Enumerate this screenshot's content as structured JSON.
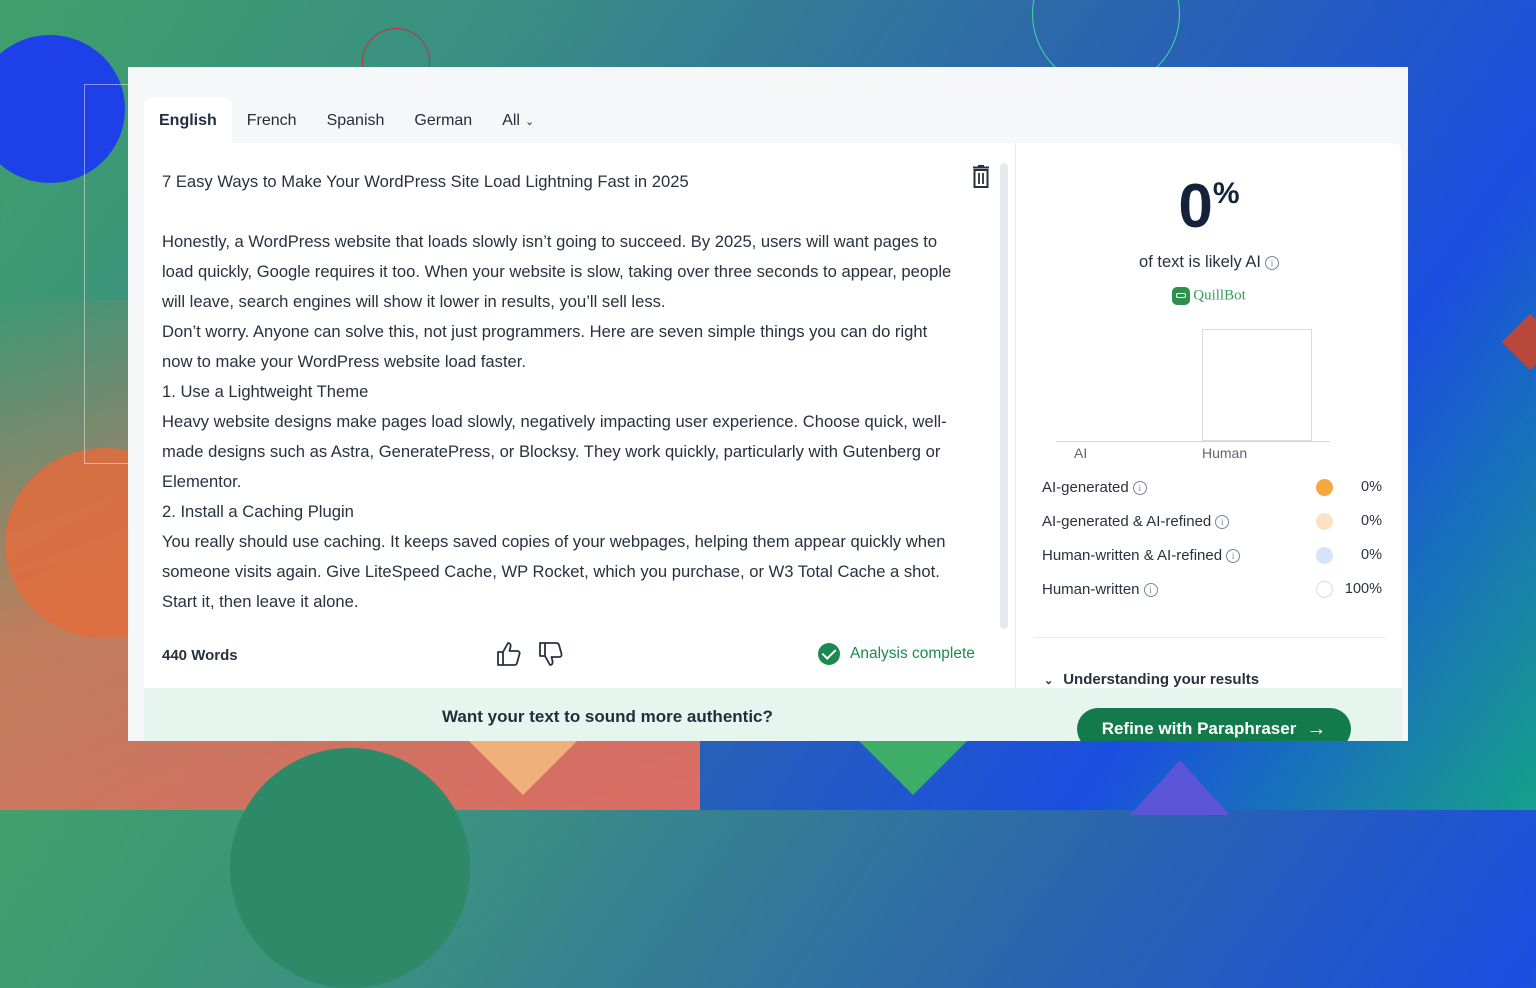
{
  "tabs": [
    {
      "label": "English",
      "active": true
    },
    {
      "label": "French"
    },
    {
      "label": "Spanish"
    },
    {
      "label": "German"
    },
    {
      "label": "All",
      "icon": "chevron-down-icon"
    }
  ],
  "editor": {
    "title": "7 Easy Ways to Make Your WordPress Site Load Lightning Fast in 2025",
    "paragraphs": [
      "Honestly, a WordPress website that loads slowly isn’t going to succeed. By 2025, users will want pages to load quickly, Google requires it too. When your website is slow, taking over three seconds to appear, people will leave, search engines will show it lower in results, you’ll sell less.",
      "Don’t worry. Anyone can solve this, not just programmers. Here are seven simple things you can do right now to make your WordPress website load faster.",
      "1. Use a Lightweight Theme",
      "Heavy website designs make pages load slowly, negatively impacting user experience. Choose quick, well-made designs such as Astra, GeneratePress, or Blocksy. They work quickly, particularly with Gutenberg or Elementor.",
      "2. Install a Caching Plugin",
      "You really should use caching. It keeps saved copies of your webpages, helping them appear quickly when someone visits again. Give LiteSpeed Cache, WP Rocket, which you purchase, or W3 Total Cache a shot. Start it, then leave it alone."
    ],
    "word_count": "440 Words",
    "status": "Analysis complete",
    "icons": {
      "delete": "trash-icon",
      "like": "thumbs-up-icon",
      "dislike": "thumbs-down-icon",
      "status": "check-circle-icon"
    }
  },
  "results": {
    "percent": "0",
    "percent_symbol": "%",
    "caption": "of text is likely AI",
    "brand": "QuillBot",
    "legend": [
      {
        "label": "AI-generated",
        "value": "0%",
        "color": "#f5a742"
      },
      {
        "label": "AI-generated & AI-refined",
        "value": "0%",
        "color": "#fbe2c4"
      },
      {
        "label": "Human-written & AI-refined",
        "value": "0%",
        "color": "#d6e4fb"
      },
      {
        "label": "Human-written",
        "value": "100%",
        "color": "#ffffff"
      }
    ],
    "understanding": "Understanding your results"
  },
  "chart_data": {
    "type": "bar",
    "categories": [
      "AI",
      "Human"
    ],
    "values": [
      0,
      100
    ],
    "ylim": [
      0,
      100
    ]
  },
  "banner": {
    "text": "Want your text to sound more authentic?",
    "button": "Refine with Paraphraser",
    "button_icon": "arrow-right-icon"
  }
}
